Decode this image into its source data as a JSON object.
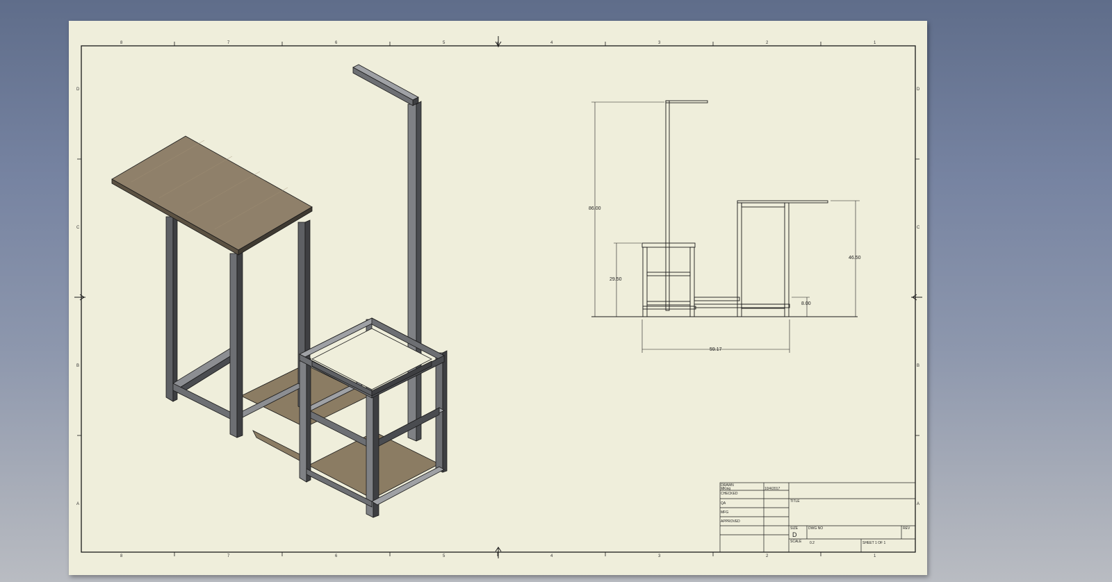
{
  "sheet": {
    "zones_top": [
      "8",
      "7",
      "6",
      "5",
      "4",
      "3",
      "2",
      "1"
    ],
    "zones_side": [
      "D",
      "C",
      "B",
      "A"
    ]
  },
  "dimensions": {
    "overall_height": "86.00",
    "seat_height": "29.50",
    "desk_height": "46.50",
    "rail_height": "8.00",
    "overall_width": "59.17"
  },
  "title_block": {
    "drawn_label": "DRAWN",
    "drawn_by": "MKing",
    "drawn_date": "10/4/2017",
    "checked_label": "CHECKED",
    "qa_label": "QA",
    "mfg_label": "MFG",
    "approved_label": "APPROVED",
    "title_label": "TITLE",
    "size_label": "SIZE",
    "size_value": "D",
    "dwg_no_label": "DWG NO",
    "rev_label": "REV",
    "scale_label": "SCALE",
    "scale_value": "0.2",
    "sheet_text": "SHEET 1  OF 1"
  },
  "colors": {
    "paper": "#efeedb",
    "line": "#1a1a1a",
    "steel_dark": "#3e3f42",
    "steel_mid": "#6d6f73",
    "steel_light": "#9fa1a5",
    "wood": "#8b7c63",
    "wood_light": "#a89675"
  }
}
